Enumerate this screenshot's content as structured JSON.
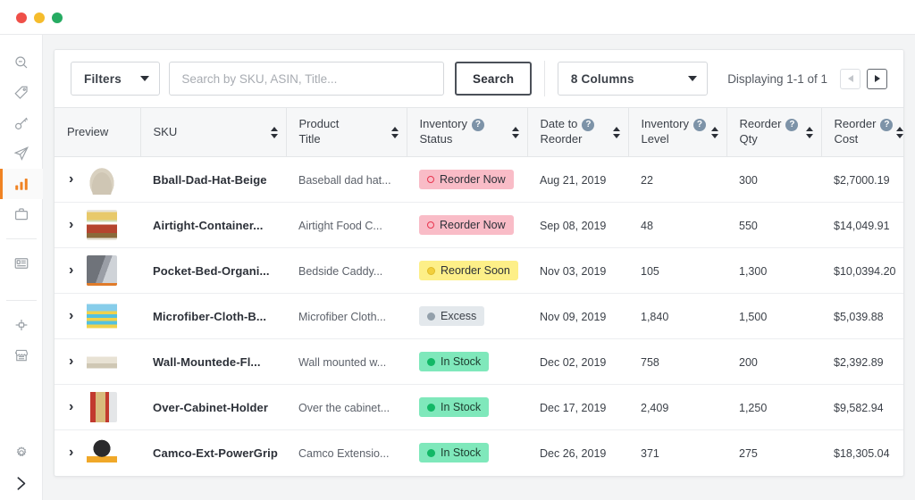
{
  "window": {
    "traffic_lights": [
      "close",
      "minimize",
      "maximize"
    ],
    "colors": {
      "close": "#ef4f48",
      "minimize": "#f5bc2c",
      "maximize": "#26ab62"
    }
  },
  "sidebar": {
    "accent_color": "#f08323",
    "groups": [
      {
        "items": [
          {
            "icon": "magnifier-icon",
            "active": false
          },
          {
            "icon": "tag-icon",
            "active": false
          },
          {
            "icon": "key-icon",
            "active": false
          },
          {
            "icon": "paper-plane-icon",
            "active": false
          },
          {
            "icon": "bar-chart-icon",
            "active": true
          },
          {
            "icon": "briefcase-icon",
            "active": false
          }
        ]
      },
      {
        "items": [
          {
            "icon": "window-dashboard-icon",
            "active": false
          }
        ]
      },
      {
        "items": [
          {
            "icon": "plug-connector-icon",
            "active": false
          },
          {
            "icon": "storefront-icon",
            "active": false
          }
        ]
      },
      {
        "items": [
          {
            "icon": "gear-icon",
            "active": false
          },
          {
            "icon": "chevron-right-icon",
            "active": false
          }
        ]
      }
    ]
  },
  "toolbar": {
    "filters_label": "Filters",
    "search_placeholder": "Search by SKU, ASIN, Title...",
    "search_value": "",
    "search_button_label": "Search",
    "columns_label": "8 Columns",
    "displaying_label": "Displaying 1-1 of 1",
    "prev_page": "◄",
    "next_page": "►",
    "prev_enabled": false,
    "next_enabled": true
  },
  "table": {
    "columns": [
      {
        "label_lines": [
          "Preview"
        ],
        "help": false,
        "sortable": false
      },
      {
        "label_lines": [
          "SKU"
        ],
        "help": false,
        "sortable": true
      },
      {
        "label_lines": [
          "Product",
          "Title"
        ],
        "help": false,
        "sortable": true
      },
      {
        "label_lines": [
          "Inventory",
          "Status"
        ],
        "help": true,
        "sortable": true
      },
      {
        "label_lines": [
          "Date to",
          "Reorder"
        ],
        "help": true,
        "sortable": true
      },
      {
        "label_lines": [
          "Inventory",
          "Level"
        ],
        "help": true,
        "sortable": true
      },
      {
        "label_lines": [
          "Reorder",
          "Qty"
        ],
        "help": true,
        "sortable": true
      },
      {
        "label_lines": [
          "Reorder",
          "Cost"
        ],
        "help": true,
        "sortable": true
      }
    ],
    "help_glyph": "?",
    "expand_glyph": "›",
    "rows": [
      {
        "thumb": "baseball-cap-thumbnail",
        "sku": "Bball-Dad-Hat-Beige",
        "title": "Baseball dad hat...",
        "status": "Reorder Now",
        "status_kind": "reorder-now",
        "date_to_reorder": "Aug 21, 2019",
        "inventory_level": "22",
        "reorder_qty": "300",
        "reorder_cost": "$2,7000.19"
      },
      {
        "thumb": "food-containers-thumbnail",
        "sku": "Airtight-Container...",
        "title": "Airtight Food C...",
        "status": "Reorder Now",
        "status_kind": "reorder-now",
        "date_to_reorder": "Sep 08, 2019",
        "inventory_level": "48",
        "reorder_qty": "550",
        "reorder_cost": "$14,049.91"
      },
      {
        "thumb": "bed-organizer-thumbnail",
        "sku": "Pocket-Bed-Organi...",
        "title": "Bedside Caddy...",
        "status": "Reorder Soon",
        "status_kind": "reorder-soon",
        "date_to_reorder": "Nov 03, 2019",
        "inventory_level": "105",
        "reorder_qty": "1,300",
        "reorder_cost": "$10,0394.20"
      },
      {
        "thumb": "cloth-stack-thumbnail",
        "sku": "Microfiber-Cloth-B...",
        "title": "Microfiber Cloth...",
        "status": "Excess",
        "status_kind": "excess",
        "date_to_reorder": "Nov 09, 2019",
        "inventory_level": "1,840",
        "reorder_qty": "1,500",
        "reorder_cost": "$5,039.88"
      },
      {
        "thumb": "wall-shelf-thumbnail",
        "sku": "Wall-Mountede-Fl...",
        "title": "Wall mounted w...",
        "status": "In Stock",
        "status_kind": "in-stock",
        "date_to_reorder": "Dec 02, 2019",
        "inventory_level": "758",
        "reorder_qty": "200",
        "reorder_cost": "$2,392.89"
      },
      {
        "thumb": "cabinet-holder-thumbnail",
        "sku": "Over-Cabinet-Holder",
        "title": "Over the cabinet...",
        "status": "In Stock",
        "status_kind": "in-stock",
        "date_to_reorder": "Dec 17, 2019",
        "inventory_level": "2,409",
        "reorder_qty": "1,250",
        "reorder_cost": "$9,582.94"
      },
      {
        "thumb": "power-grip-thumbnail",
        "sku": "Camco-Ext-PowerGrip",
        "title": "Camco Extensio...",
        "status": "In Stock",
        "status_kind": "in-stock",
        "date_to_reorder": "Dec 26, 2019",
        "inventory_level": "371",
        "reorder_qty": "275",
        "reorder_cost": "$18,305.04"
      }
    ]
  },
  "status_colors": {
    "reorder_now_bg": "#f9bcc7",
    "reorder_now_dot": "#e8344e",
    "reorder_soon_bg": "#fdef88",
    "reorder_soon_dot": "#f2cf3c",
    "excess_bg": "#e3e8ec",
    "excess_dot": "#93a0ab",
    "in_stock_bg": "#7fe8bb",
    "in_stock_dot": "#12b866"
  }
}
